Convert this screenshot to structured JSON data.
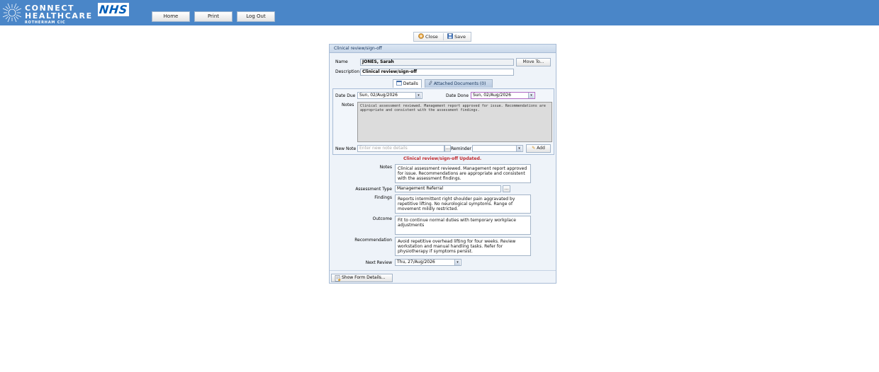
{
  "header": {
    "logo": {
      "line1": "CONNECT",
      "line2": "HEALTHCARE",
      "line3": "ROTHERHAM CIC"
    },
    "nhs_logo": "NHS",
    "nav": [
      {
        "label": "Home"
      },
      {
        "label": "Print"
      },
      {
        "label": "Log Out"
      }
    ],
    "colors": {
      "bar": "#4a86c8"
    }
  },
  "actions": {
    "close_label": "Close",
    "save_label": "Save"
  },
  "panel": {
    "title": "Clinical review/sign-off",
    "name_label": "Name",
    "name_value": "JONES, Sarah",
    "move_to_label": "Move To...",
    "description_label": "Description",
    "description_value": "Clinical review/sign-off",
    "tabs": [
      {
        "label": "Details",
        "icon": "calendar-icon",
        "active": true
      },
      {
        "label": "Attached Documents (0)",
        "icon": "paperclip-icon",
        "active": false
      }
    ],
    "details": {
      "date_due_label": "Date Due",
      "date_due_value": "Sun, 02/Aug/2026",
      "date_done_label": "Date Done",
      "date_done_value": "Sun, 02/Aug/2026",
      "notes_label": "Notes",
      "notes_value": "Clinical assessment reviewed. Management report approved for issue. Recommendations are appropriate and consistent with the assessment findings.",
      "new_note_label": "New Note",
      "new_note_placeholder": "Enter new note details",
      "ellipsis": "...",
      "reminder_label": "Reminder",
      "reminder_value": "",
      "add_label": "Add"
    },
    "status_message": "Clinical review/sign-off Updated.",
    "form": {
      "notes_label": "Notes",
      "notes_value": "Clinical assessment reviewed. Management report approved for issue. Recommendations are appropriate and consistent with the assessment findings.",
      "assessment_type_label": "Assessment Type",
      "assessment_type_value": "Management Referral",
      "ellipsis": "...",
      "findings_label": "Findings",
      "findings_value": "Reports intermittent right shoulder pain aggravated by repetitive lifting. No neurological symptoms. Range of movement mildly restricted.",
      "outcome_label": "Outcome",
      "outcome_value": "Fit to continue normal duties with temporary workplace adjustments",
      "recommendation_label": "Recommendation",
      "recommendation_value": "Avoid repetitive overhead lifting for four weeks. Review workstation and manual handling tasks. Refer for physiotherapy if symptoms persist.",
      "next_review_label": "Next Review",
      "next_review_value": "Thu, 27/Aug/2026"
    },
    "show_form_details_label": "Show Form Details..."
  }
}
